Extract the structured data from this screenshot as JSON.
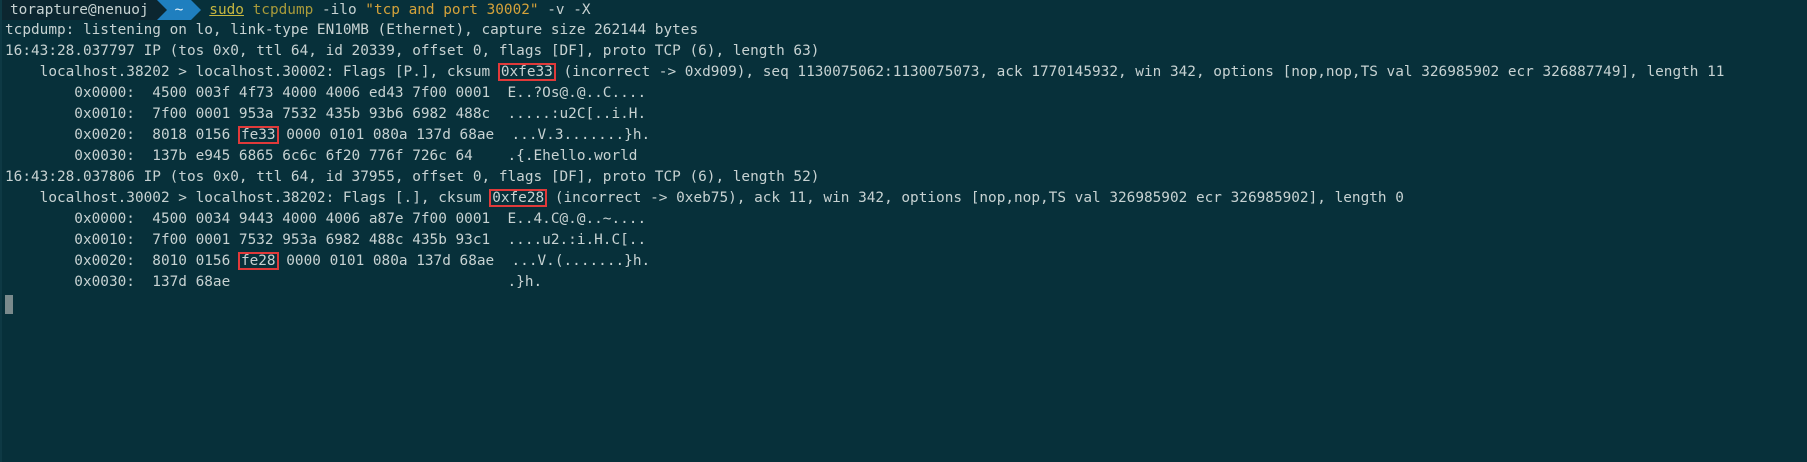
{
  "prompt": {
    "user_host": "torapture@nenuoj",
    "dir": "~",
    "cmd_sudo": "sudo",
    "cmd_bin": "tcpdump",
    "cmd_arg1": "-ilo",
    "cmd_str": "\"tcp and port 30002\"",
    "cmd_arg2": "-v -X"
  },
  "lines": {
    "l1": "tcpdump: listening on lo, link-type EN10MB (Ethernet), capture size 262144 bytes",
    "l2": "16:43:28.037797 IP (tos 0x0, ttl 64, id 20339, offset 0, flags [DF], proto TCP (6), length 63)",
    "l3_pre": "    localhost.38202 > localhost.30002: Flags [P.], cksum ",
    "l3_box": "0xfe33",
    "l3_post": " (incorrect -> 0xd909), seq 1130075062:1130075073, ack 1770145932, win 342, options [nop,nop,TS val 326985902 ecr 326887749], length 11",
    "h1": "        0x0000:  4500 003f 4f73 4000 4006 ed43 7f00 0001  E..?Os@.@..C....",
    "h2": "        0x0010:  7f00 0001 953a 7532 435b 93b6 6982 488c  .....:u2C[..i.H.",
    "h3_pre": "        0x0020:  8018 0156 ",
    "h3_box": "fe33",
    "h3_post": " 0000 0101 080a 137d 68ae  ...V.3.......}h.",
    "h4": "        0x0030:  137b e945 6865 6c6c 6f20 776f 726c 64    .{.Ehello.world",
    "l4": "16:43:28.037806 IP (tos 0x0, ttl 64, id 37955, offset 0, flags [DF], proto TCP (6), length 52)",
    "l5_pre": "    localhost.30002 > localhost.38202: Flags [.], cksum ",
    "l5_box": "0xfe28",
    "l5_post": " (incorrect -> 0xeb75), ack 11, win 342, options [nop,nop,TS val 326985902 ecr 326985902], length 0",
    "h5": "        0x0000:  4500 0034 9443 4000 4006 a87e 7f00 0001  E..4.C@.@..~....",
    "h6": "        0x0010:  7f00 0001 7532 953a 6982 488c 435b 93c1  ....u2.:i.H.C[..",
    "h7_pre": "        0x0020:  8010 0156 ",
    "h7_box": "fe28",
    "h7_post": " 0000 0101 080a 137d 68ae  ...V.(.......}h.",
    "h8": "        0x0030:  137d 68ae                                .}h."
  },
  "colors": {
    "background": "#07303a",
    "text": "#c7d2d2",
    "highlight_box": "#e03a3a",
    "dir_segment": "#1f7fbf"
  }
}
